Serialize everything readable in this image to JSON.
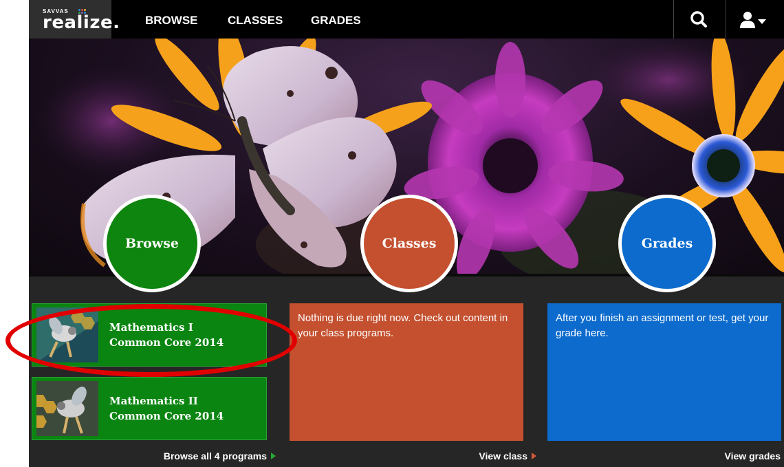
{
  "header": {
    "logo_small": "SAVVAS",
    "logo_brand": "realize.",
    "nav": [
      "BROWSE",
      "CLASSES",
      "GRADES"
    ],
    "icons": [
      "search-icon",
      "user-icon",
      "caret-down-icon"
    ]
  },
  "hero": {
    "circles": {
      "browse": "Browse",
      "classes": "Classes",
      "grades": "Grades"
    }
  },
  "programs": [
    {
      "title_line1": "Mathematics I",
      "title_line2": "Common Core 2014"
    },
    {
      "title_line1": "Mathematics II",
      "title_line2": "Common Core 2014"
    }
  ],
  "classes_panel": {
    "text": "Nothing is due right now. Check out content in your class programs."
  },
  "grades_panel": {
    "text": "After you finish an assignment or test, get your grade here."
  },
  "footer_links": {
    "browse": "Browse all 4 programs",
    "class": "View class",
    "grades": "View grades"
  },
  "colors": {
    "browse_green": "#0e850e",
    "classes_orange": "#c4502f",
    "grades_blue": "#0c6bcd",
    "annotation_red": "#e10000"
  }
}
